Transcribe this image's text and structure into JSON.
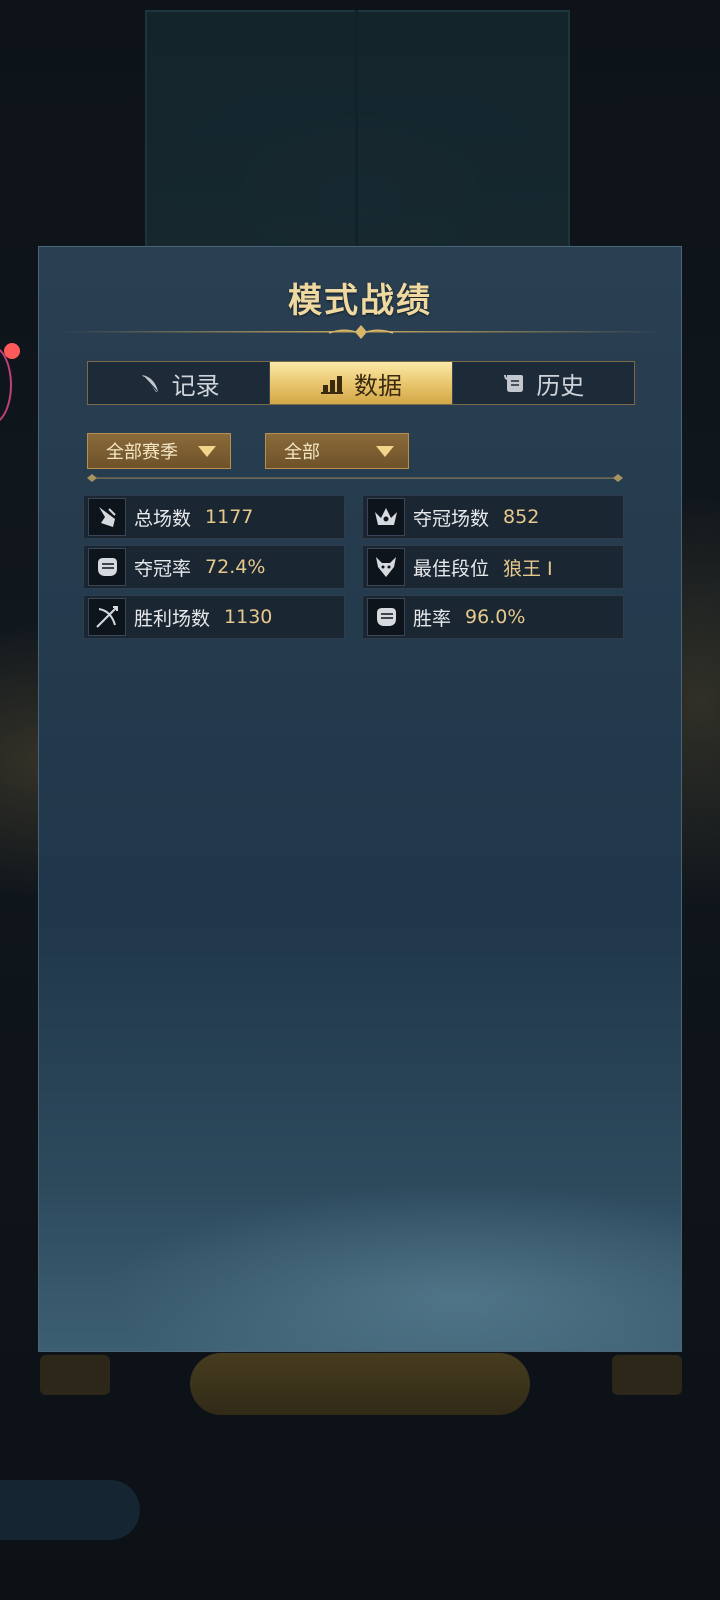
{
  "modal": {
    "title": "模式战绩"
  },
  "tabs": [
    {
      "label": "记录",
      "icon": "quill-icon",
      "active": false
    },
    {
      "label": "数据",
      "icon": "bar-chart-icon",
      "active": true
    },
    {
      "label": "历史",
      "icon": "scroll-icon",
      "active": false
    }
  ],
  "filters": {
    "season": "全部赛季",
    "mode": "全部"
  },
  "stats": [
    {
      "label": "总场数",
      "value": "1177",
      "icon": "wolf-fang-icon"
    },
    {
      "label": "夺冠场数",
      "value": "852",
      "icon": "crown-icon"
    },
    {
      "label": "夺冠率",
      "value": "72.4%",
      "icon": "fist-icon"
    },
    {
      "label": "最佳段位",
      "value": "狼王 I",
      "icon": "wolf-head-icon"
    },
    {
      "label": "胜利场数",
      "value": "1130",
      "icon": "crossbow-icon"
    },
    {
      "label": "胜率",
      "value": "96.0%",
      "icon": "fist-icon"
    }
  ],
  "colors": {
    "accent_gold": "#e8c46a",
    "value_gold": "#e6c98c",
    "title_gold": "#f0d9a0"
  }
}
